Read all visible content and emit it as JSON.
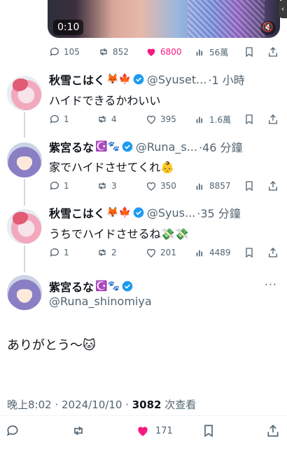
{
  "video": {
    "time": "0:10"
  },
  "quoted_actions": {
    "replies": "105",
    "retweets": "852",
    "likes": "6800",
    "views": "56萬"
  },
  "replies": [
    {
      "name": "秋雪こはく",
      "emojis": "🦊🍁",
      "handle": "@Syuset...",
      "time": "·1 小時",
      "text": "ハイドできるかわいい",
      "replies": "1",
      "retweets": "4",
      "likes": "395",
      "views": "1.6萬"
    },
    {
      "name": "紫宮るな",
      "emojis": "☪️🐾",
      "handle": "@Runa_s...",
      "time": "·46 分鐘",
      "text": "家でハイドさせてくれ👶",
      "replies": "1",
      "retweets": "3",
      "likes": "350",
      "views": "8857"
    },
    {
      "name": "秋雪こはく",
      "emojis": "🦊🍁",
      "handle": "@Syus...",
      "time": "·35 分鐘",
      "text": "うちでハイドさせるね💸💸",
      "replies": "1",
      "retweets": "2",
      "likes": "201",
      "views": "4489"
    }
  ],
  "main_tweet": {
    "name": "紫宮るな",
    "emojis": "☪️🐾",
    "handle": "@Runa_shinomiya",
    "text": "ありがとう～🐱",
    "time": "晚上8:02 · 2024/10/10 · ",
    "views_count": "3082",
    "views_label": " 次查看",
    "likes": "171"
  },
  "more_glyph": "···",
  "colors": {
    "like_pink": "#f91880",
    "verified_blue": "#1d9bf0",
    "muted_gray": "#536471"
  }
}
